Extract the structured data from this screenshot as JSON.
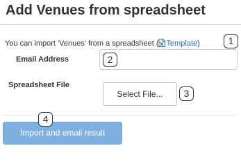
{
  "page": {
    "title": "Add Venues from spreadsheet"
  },
  "intro": {
    "prefix": "You can import 'Venues' from a spreadsheet (",
    "template_link": "Template",
    "suffix": ")",
    "template_icon": "spreadsheet-icon"
  },
  "form": {
    "email_label": "Email Address",
    "email_value": "",
    "file_label": "Spreadsheet File",
    "file_button": "Select File..."
  },
  "actions": {
    "submit_label": "Import and email result"
  },
  "callouts": [
    "1",
    "2",
    "3",
    "4"
  ],
  "colors": {
    "link": "#2a6ab5",
    "primary_button": "#7fb1e0"
  }
}
